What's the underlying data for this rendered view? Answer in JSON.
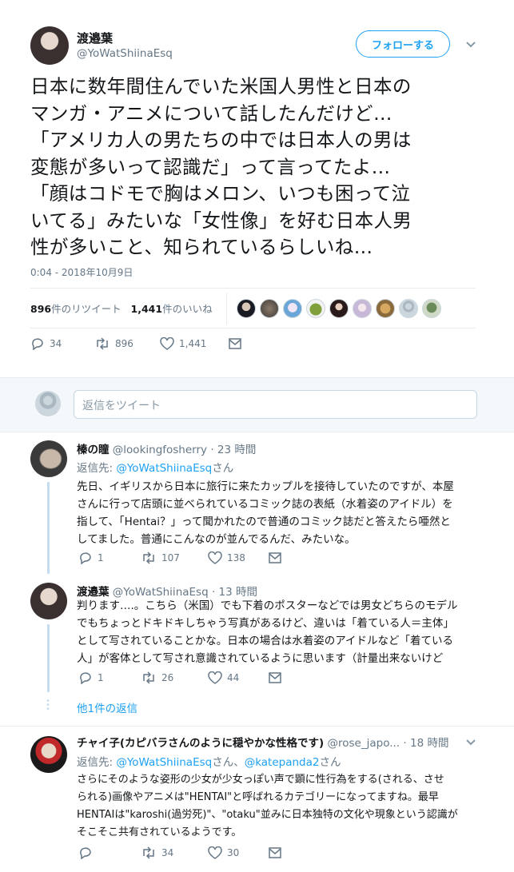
{
  "tweet": {
    "display_name": "渡邉葉",
    "handle": "@YoWatShiinaEsq",
    "follow_label": "フォローする",
    "lines": [
      "日本に数年間住んでいた米国人男性と日本の",
      "マンガ・アニメについて話したんだけど…",
      "「アメリカ人の男たちの中では日本人の男は",
      "変態が多いって認識だ」って言ってたよ…",
      "「顔はコドモで胸はメロン、いつも困って泣",
      "いてる」みたいな「女性像」を好む日本人男",
      "性が多いこと、知られているらしいね…"
    ],
    "timestamp": "0:04 - 2018年10月9日",
    "retweets_count": "896",
    "retweets_label": "件のリツイート",
    "likes_count": "1,441",
    "likes_label": "件のいいね",
    "reply_count": "34",
    "retweet_count": "896",
    "like_count": "1,441"
  },
  "reply_box": {
    "placeholder": "返信をツイート"
  },
  "replies": [
    {
      "display_name": "榛の瞳",
      "handle": "@lookingfosherry",
      "time": "· 23 時間",
      "reply_to_prefix": "返信先: ",
      "reply_to_user": "@YoWatShiinaEsq",
      "reply_to_suffix": "さん",
      "lines": [
        "先日、イギリスから日本に旅行に来たカップルを接待していたのですが、本屋",
        "さんに行って店頭に並べられているコミック誌の表紙（水着姿のアイドル）を",
        "指して、「Hentai？」って聞かれたので普通のコミック誌だと答えたら唖然と",
        "してました。普通にこんなのが並んでるんだ、みたいな。"
      ],
      "reply_count": "1",
      "retweet_count": "107",
      "like_count": "138"
    },
    {
      "display_name": "渡邉葉",
      "handle": "@YoWatShiinaEsq",
      "time": "· 13 時間",
      "lines": [
        "判ります….。こちら（米国）でも下着のポスターなどでは男女どちらのモデル",
        "でもちょっとドキドキしちゃう写真があるけど、違いは「着ている人＝主体」",
        "として写されていることかな。日本の場合は水着姿のアイドルなど「着ている",
        "人」が客体として写され意識されているように思います（計量出来ないけど"
      ],
      "reply_count": "1",
      "retweet_count": "26",
      "like_count": "44",
      "more_replies": "他1件の返信"
    },
    {
      "display_name": "チャイ子(カピバラさんのように穏やかな性格です)",
      "handle": "@rose_japo...",
      "time": "· 18 時間",
      "reply_to_prefix": "返信先: ",
      "reply_to_user": "@YoWatShiinaEsq",
      "reply_to_mid": "さん、",
      "reply_to_user2": "@katepanda2",
      "reply_to_suffix": "さん",
      "lines": [
        "さらにそのような姿形の少女が少女っぽい声で顕に性行為をする(される、させ",
        "られる)画像やアニメは\"HENTAI\"と呼ばれるカテゴリーになってますね。最早",
        "HENTAIは\"karoshi(過労死)\"、\"otaku\"並みに日本独特の文化や現象という認識が",
        "そこそこ共有されているようです。"
      ],
      "retweet_count": "34",
      "like_count": "30"
    }
  ],
  "colors": {
    "accent": "#1da1f2",
    "secondary_text": "#657786",
    "divider": "#e6ecf0"
  }
}
